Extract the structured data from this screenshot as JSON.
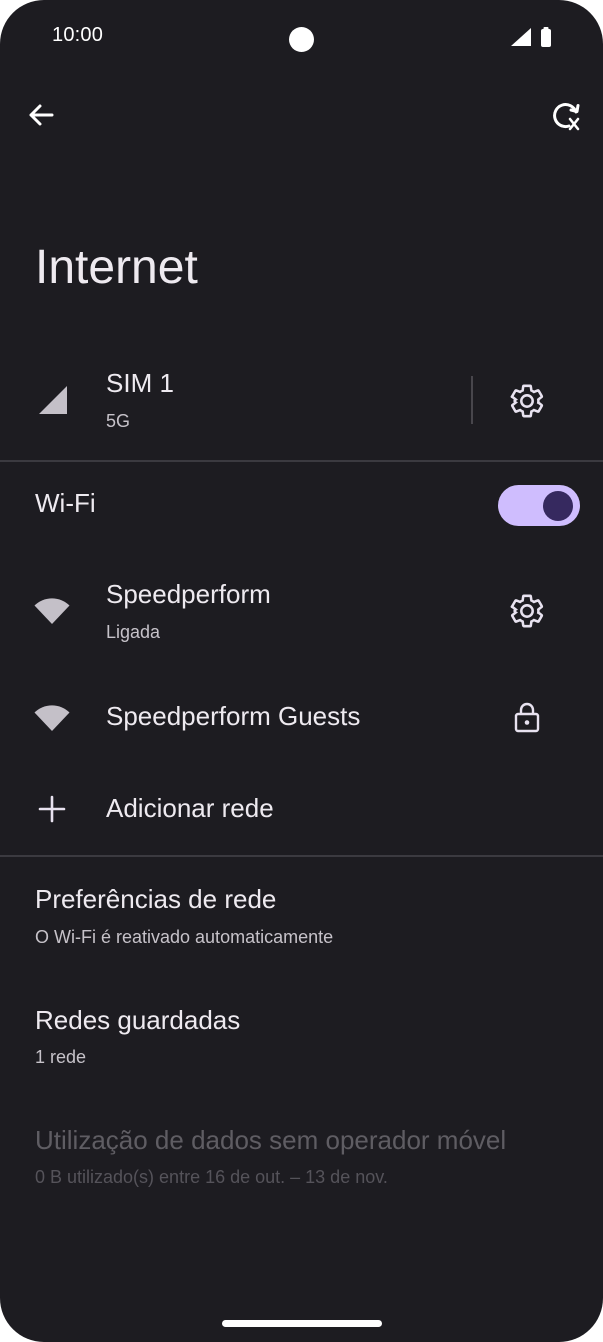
{
  "status_bar": {
    "time": "10:00"
  },
  "toolbar": {
    "back_icon": "arrow-back-icon",
    "reset_icon": "network-reset-icon"
  },
  "page": {
    "title": "Internet"
  },
  "sim": {
    "name": "SIM 1",
    "network": "5G"
  },
  "wifi": {
    "label": "Wi-Fi",
    "enabled": true,
    "networks": [
      {
        "name": "Speedperform",
        "status": "Ligada",
        "action_icon": "gear-icon"
      },
      {
        "name": "Speedperform Guests",
        "status": "",
        "action_icon": "lock-icon"
      }
    ],
    "add_network": "Adicionar rede"
  },
  "preferences": {
    "title": "Preferências de rede",
    "subtitle": "O Wi-Fi é reativado automaticamente"
  },
  "saved": {
    "title": "Redes guardadas",
    "subtitle": "1 rede"
  },
  "data_usage": {
    "title": "Utilização de dados sem operador móvel",
    "subtitle": "0 B utilizado(s) entre 16 de out. – 13 de nov."
  },
  "colors": {
    "background": "#1d1c21",
    "accent": "#cfbdfe",
    "toggle_knob": "#36295f"
  }
}
